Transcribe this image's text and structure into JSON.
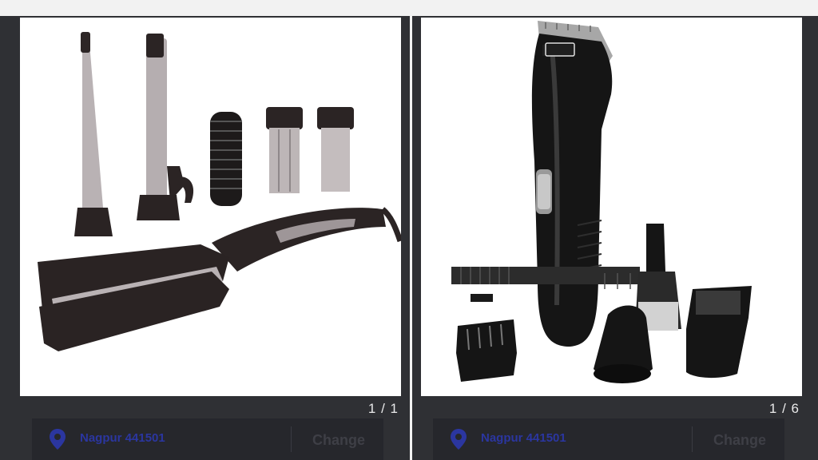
{
  "left_panel": {
    "image_icon": "hair-styler-product-image",
    "counter": "1 / 1",
    "location": "Nagpur 441501",
    "change_label": "Change",
    "pin_icon": "location-pin-icon"
  },
  "right_panel": {
    "image_icon": "trimmer-product-image",
    "counter": "1 / 6",
    "location": "Nagpur 441501",
    "change_label": "Change",
    "pin_icon": "location-pin-icon"
  },
  "colors": {
    "panel_bg": "#2f3034",
    "location_text": "#2b36a0",
    "counter_text": "#e9e9ea"
  }
}
